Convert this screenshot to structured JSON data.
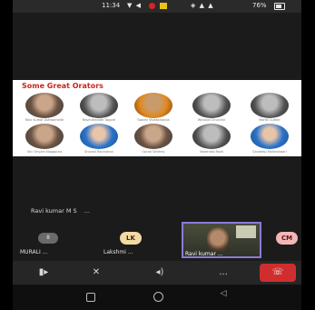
{
  "status_bar": {
    "time": "11:34",
    "battery_percent": "76%"
  },
  "shared_screen": {
    "title": "Some Great Orators",
    "orators": [
      {
        "name": "Ravi Kumar Ashwamedh",
        "icon": "orator-photo"
      },
      {
        "name": "Ravindranath Tagore",
        "icon": "orator-photo"
      },
      {
        "name": "Swami Vivekananda",
        "icon": "orator-photo"
      },
      {
        "name": "Winston Churchill",
        "icon": "orator-photo"
      },
      {
        "name": "Martin Luther",
        "icon": "orator-photo"
      },
      {
        "name": "Shri Shyam Nagapura",
        "icon": "orator-photo"
      },
      {
        "name": "Shivani Ravindran",
        "icon": "orator-photo"
      },
      {
        "name": "Oprah Winfrey",
        "icon": "orator-photo"
      },
      {
        "name": "Narendra Modi",
        "icon": "orator-photo"
      },
      {
        "name": "Sandeep Maheshwari",
        "icon": "orator-photo"
      }
    ]
  },
  "speaker": {
    "label": "Ravi kumar M S",
    "more": "..."
  },
  "participants": [
    {
      "name": "MURALI ...",
      "control": "II"
    },
    {
      "name": "Lakshmi ...",
      "initials": "LK"
    },
    {
      "name": "Ravi kumar ...",
      "video": true
    },
    {
      "initials": "CM"
    }
  ],
  "toolbar": {
    "camera": "camera-icon",
    "mic": "mic-off-icon",
    "speaker": "speaker-icon",
    "more": "...",
    "end": "end-call-icon"
  },
  "colors": {
    "accent": "#8a7ad9",
    "end_call": "#d02e2e",
    "title_red": "#c8281e"
  }
}
